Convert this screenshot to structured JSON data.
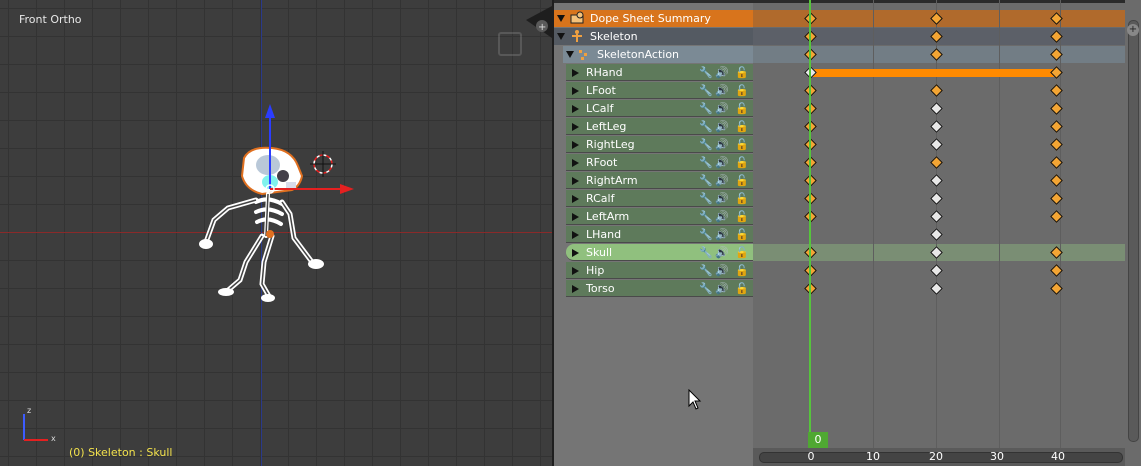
{
  "viewport": {
    "label": "Front Ortho",
    "status": "(0) Skeleton : Skull"
  },
  "dopesheet": {
    "summary_label": "Dope Sheet Summary",
    "object_label": "Skeleton",
    "action_label": "SkeletonAction",
    "bones": [
      {
        "name": "RHand",
        "selected": false
      },
      {
        "name": "LFoot",
        "selected": false
      },
      {
        "name": "LCalf",
        "selected": false
      },
      {
        "name": "LeftLeg",
        "selected": false
      },
      {
        "name": "RightLeg",
        "selected": false
      },
      {
        "name": "RFoot",
        "selected": false
      },
      {
        "name": "RightArm",
        "selected": false
      },
      {
        "name": "RCalf",
        "selected": false
      },
      {
        "name": "LeftArm",
        "selected": false
      },
      {
        "name": "LHand",
        "selected": false
      },
      {
        "name": "Skull",
        "selected": true
      },
      {
        "name": "Hip",
        "selected": false
      },
      {
        "name": "Torso",
        "selected": false
      }
    ]
  },
  "timeline": {
    "current_frame": "0",
    "ruler_labels": [
      "0",
      "10",
      "20",
      "30",
      "40"
    ]
  },
  "colors": {
    "summary_row": "#d8741c",
    "selected_keyframe": "#f3a534",
    "unselected_keyframe": "#e8e8e8",
    "playhead": "#56c43c",
    "hold_bar": "#ff8a00"
  }
}
